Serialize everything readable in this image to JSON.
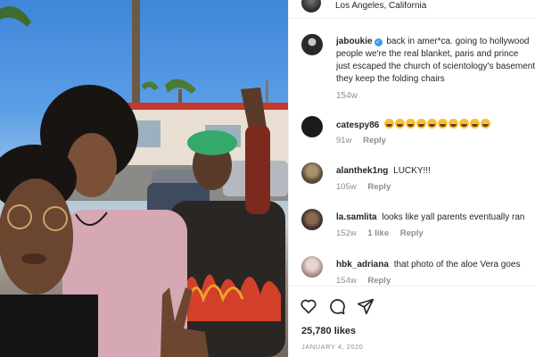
{
  "post": {
    "location": "Los Angeles, California",
    "caption": {
      "username": "jaboukie",
      "verified_symbol": "✓",
      "lines": [
        "back in amer*ca. going to hollywood",
        "people we're the real blanket, paris and prince",
        "just escaped the church of scientology's basement",
        "they keep the folding chairs"
      ],
      "time": "154w"
    },
    "comments": [
      {
        "username": "catespy86",
        "text": "🤣🤣🤣🤣🤣🤣🤣🤣🤣🤣",
        "emoji_count": 10,
        "time": "91w",
        "likes": "",
        "reply": "Reply",
        "avatar_color": "#1b1b1b"
      },
      {
        "username": "alanthek1ng",
        "text": "LUCKY!!!",
        "time": "105w",
        "likes": "",
        "reply": "Reply",
        "avatar_color": "#7b6a55"
      },
      {
        "username": "la.samlita",
        "text": "looks like yall parents eventually ran",
        "time": "152w",
        "likes": "1 like",
        "reply": "Reply",
        "avatar_color": "#5b4a40"
      },
      {
        "username": "hbk_adriana",
        "text": "that photo of the aloe Vera goes",
        "time": "154w",
        "likes": "",
        "reply": "Reply",
        "avatar_color": "#c9b8b2"
      }
    ],
    "likes": "25,780 likes",
    "date": "JANUARY 4, 2020"
  },
  "colors": {
    "verified": "#3897f0",
    "muted": "#8e8e8e",
    "text": "#262626"
  },
  "icons": [
    "heart-icon",
    "comment-icon",
    "share-icon"
  ]
}
